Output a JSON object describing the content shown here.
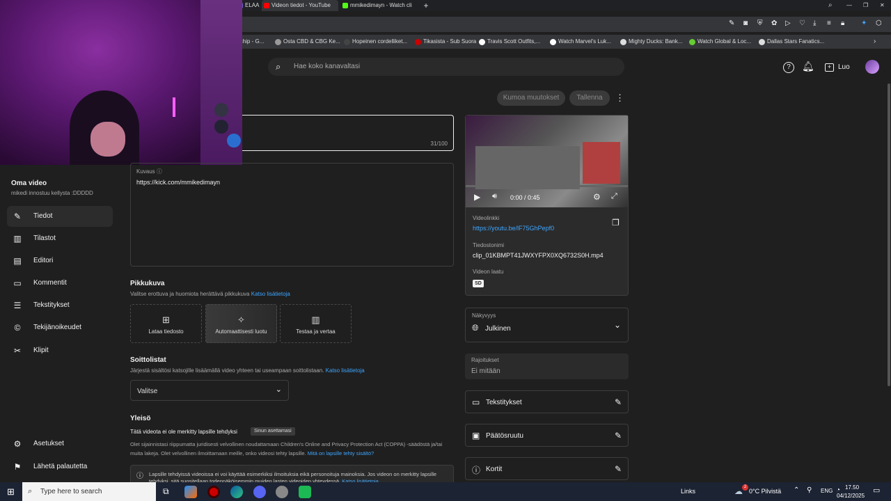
{
  "browser": {
    "tabs": [
      {
        "label": "ELAA",
        "color": "#6a5acd",
        "active": false
      },
      {
        "label": "Videon tiedot - YouTube",
        "color": "#ff0000",
        "active": true
      },
      {
        "label": "mmikedimayn - Watch cli",
        "color": "#53fc18",
        "active": false
      }
    ],
    "new_tab_icon": "plus-icon",
    "bookmarks": [
      {
        "label": "rship - G...",
        "color": "#888"
      },
      {
        "label": "Osta CBD & CBG Ke...",
        "color": "#999"
      },
      {
        "label": "Hopeinen cordelliket...",
        "color": "#444"
      },
      {
        "label": "Tikasista - Sub Suora",
        "color": "#c00"
      },
      {
        "label": "Travis Scott Outfits,...",
        "color": "#fff"
      },
      {
        "label": "Watch Marvel's Luk...",
        "color": "#fff"
      },
      {
        "label": "Mighty Ducks: Bank...",
        "color": "#ddd"
      },
      {
        "label": "Watch Global & Loc...",
        "color": "#6c3"
      },
      {
        "label": "Dallas Stars Fanatics...",
        "color": "#ddd"
      }
    ]
  },
  "header": {
    "search_placeholder": "Hae koko kanavaltasi",
    "create_label": "Luo"
  },
  "toolbar": {
    "undo_label": "Kumoa muutokset",
    "save_label": "Tallenna"
  },
  "title_field": {
    "counter": "31/100"
  },
  "sidebar": {
    "video_title": "Oma video",
    "video_subtitle": "mikedi innostuu kellysta :DDDDD",
    "items": [
      {
        "label": "Tiedot",
        "icon": "pencil-icon",
        "active": true
      },
      {
        "label": "Tilastot",
        "icon": "analytics-icon",
        "active": false
      },
      {
        "label": "Editori",
        "icon": "film-icon",
        "active": false
      },
      {
        "label": "Kommentit",
        "icon": "comment-icon",
        "active": false
      },
      {
        "label": "Tekstitykset",
        "icon": "subtitles-icon",
        "active": false
      },
      {
        "label": "Tekijänoikeudet",
        "icon": "copyright-icon",
        "active": false
      },
      {
        "label": "Klipit",
        "icon": "scissors-icon",
        "active": false
      }
    ],
    "bottom_items": [
      {
        "label": "Asetukset",
        "icon": "gear-icon"
      },
      {
        "label": "Lähetä palautetta",
        "icon": "feedback-icon"
      }
    ]
  },
  "description": {
    "label": "Kuvaus",
    "value": "https://kick.com/mmikedimayn"
  },
  "thumbnail": {
    "heading": "Pikkukuva",
    "hint": "Valitse erottuva ja huomiota herättävä pikkukuva",
    "hint_link": "Katso lisätietoja",
    "options": [
      {
        "label": "Lataa tiedosto",
        "icon": "upload-image-icon"
      },
      {
        "label": "Automaattisesti luotu",
        "icon": "sparkle-icon"
      },
      {
        "label": "Testaa ja vertaa",
        "icon": "chart-icon"
      }
    ]
  },
  "playlists": {
    "heading": "Soittolistat",
    "hint": "Järjestä sisältösi katsojille lisäämällä video yhteen tai useampaan soittolistaan.",
    "hint_link": "Katso lisätietoja",
    "select_value": "Valitse"
  },
  "audience": {
    "heading": "Yleisö",
    "status": "Tätä videota ei ole merkitty lapsille tehdyksi",
    "badge": "Sinun asettamasi",
    "body": "Olet sijainnistasi riippumatta juridisesti velvollinen noudattamaan Children's Online and Privacy Protection Act (COPPA) -säädöstä ja/tai muita lakeja. Olet velvollinen ilmoittamaan meille, onko videosi tehty lapsille.",
    "body_link": "Mitä on lapsille tehty sisältö?",
    "notice": "Lapsille tehdyissä videoissa ei voi käyttää esimerkiksi ilmoituksia eikä personoituja mainoksia. Jos videon on merkitty lapsille tehdyksi, sitä suositellaan todennäköisemmin muiden lasten videoiden yhteydessä.",
    "notice_link": "Katso lisätietoja"
  },
  "video": {
    "time": "0:00 / 0:45",
    "link_label": "Videolinkki",
    "link_value": "https://youtu.be/lF75GhPepf0",
    "filename_label": "Tiedostonimi",
    "filename_value": "clip_01KBMPT41JWXYFPX0XQ6732S0H.mp4",
    "quality_label": "Videon laatu",
    "quality_badge": "SD"
  },
  "visibility": {
    "label": "Näkyvyys",
    "value": "Julkinen"
  },
  "restrictions": {
    "label": "Rajoitukset",
    "value": "Ei mitään"
  },
  "right_rows": [
    {
      "label": "Tekstitykset",
      "icon": "subtitles-icon"
    },
    {
      "label": "Päätösruutu",
      "icon": "endscreen-icon"
    },
    {
      "label": "Kortit",
      "icon": "info-icon"
    }
  ],
  "taskbar": {
    "search_placeholder": "Type here to search",
    "links_label": "Links",
    "weather": "0°C  Pilvistä",
    "lang": "ENG",
    "time": "17.50",
    "date": "04/12/2025",
    "weather_badge": "2"
  }
}
